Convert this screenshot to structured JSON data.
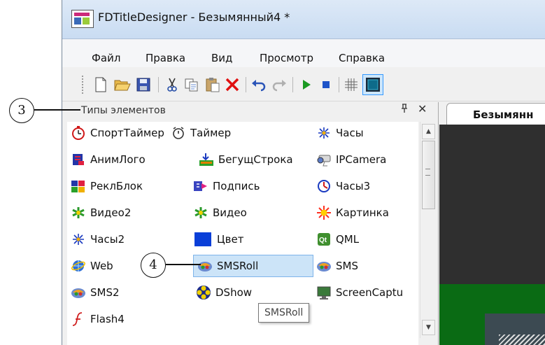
{
  "window": {
    "title": "FDTitleDesigner - Безымянный4 *"
  },
  "menu": [
    "Файл",
    "Правка",
    "Вид",
    "Просмотр",
    "Справка"
  ],
  "toolbar_icons": [
    "new-file-icon",
    "open-folder-icon",
    "save-icon",
    "cut-icon",
    "copy-icon",
    "paste-icon",
    "delete-icon",
    "undo-icon",
    "redo-icon",
    "play-icon",
    "stop-icon",
    "grid-icon",
    "frame-icon"
  ],
  "panel": {
    "title": "Типы элементов",
    "pin_glyph": "ᵖ",
    "close_glyph": "✕",
    "items": [
      {
        "label": "СпортТаймер",
        "icon": "sport-timer-icon"
      },
      {
        "label": "Таймер",
        "icon": "timer-icon"
      },
      {
        "label": "Часы",
        "icon": "clock-icon"
      },
      {
        "label": "АнимЛого",
        "icon": "anim-logo-icon"
      },
      {
        "label": "БегущСтрока",
        "icon": "ticker-icon"
      },
      {
        "label": "IPCamera",
        "icon": "ip-camera-icon"
      },
      {
        "label": "РеклБлок",
        "icon": "ad-block-icon"
      },
      {
        "label": "Подпись",
        "icon": "caption-icon"
      },
      {
        "label": "Часы3",
        "icon": "clock3-icon"
      },
      {
        "label": "Видео2",
        "icon": "video2-icon"
      },
      {
        "label": "Видео",
        "icon": "video-icon"
      },
      {
        "label": "Картинка",
        "icon": "picture-icon"
      },
      {
        "label": "Часы2",
        "icon": "clock2-icon"
      },
      {
        "label": "Цвет",
        "icon": "color-icon"
      },
      {
        "label": "QML",
        "icon": "qml-icon"
      },
      {
        "label": "Web",
        "icon": "web-icon"
      },
      {
        "label": "SMSRoll",
        "icon": "smsroll-icon",
        "selected": true
      },
      {
        "label": "SMS",
        "icon": "sms-icon"
      },
      {
        "label": "SMS2",
        "icon": "sms2-icon"
      },
      {
        "label": "DShow",
        "icon": "dshow-icon"
      },
      {
        "label": "ScreenCaptu",
        "icon": "screen-capture-icon"
      },
      {
        "label": "Flash4",
        "icon": "flash-icon"
      }
    ]
  },
  "document": {
    "tab_label": "Безымянн"
  },
  "tooltip": "SMSRoll",
  "callouts": {
    "a": "3",
    "b": "4"
  },
  "colors": {
    "selection": "#cce4f8",
    "canvas_green": "#0a6b14",
    "color_swatch": "#0a3fd8"
  }
}
